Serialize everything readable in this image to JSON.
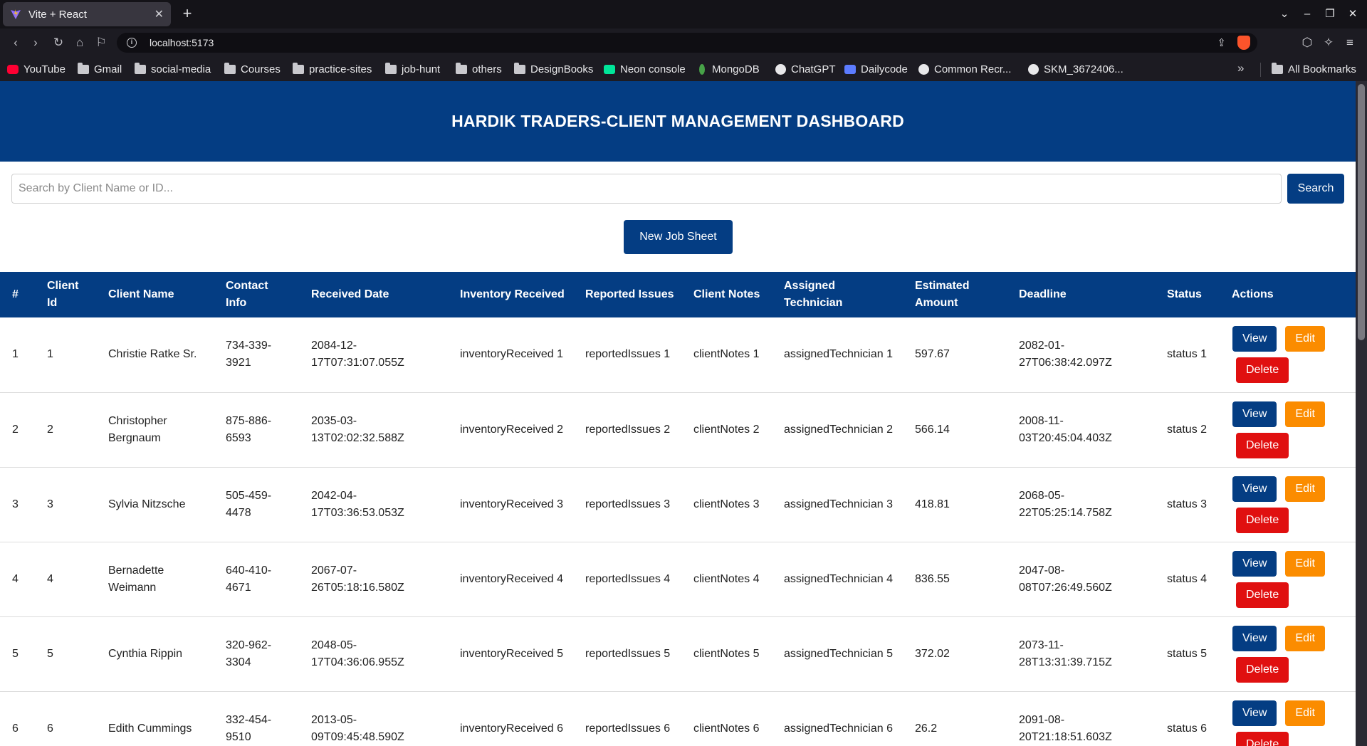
{
  "browser": {
    "tab_title": "Vite + React",
    "tab_close": "✕",
    "new_tab": "+",
    "url": "localhost:5173",
    "bookmarks": [
      {
        "label": "YouTube",
        "icon": "youtube-icon"
      },
      {
        "label": "Gmail",
        "icon": "folder-icon"
      },
      {
        "label": "social-media",
        "icon": "folder-icon"
      },
      {
        "label": "Courses",
        "icon": "folder-icon"
      },
      {
        "label": "practice-sites",
        "icon": "folder-icon"
      },
      {
        "label": "job-hunt",
        "icon": "folder-icon"
      },
      {
        "label": "others",
        "icon": "folder-icon"
      },
      {
        "label": "DesignBooks",
        "icon": "folder-icon"
      },
      {
        "label": "Neon console",
        "icon": "neon-icon"
      },
      {
        "label": "MongoDB",
        "icon": "mongodb-leaf-icon"
      },
      {
        "label": "ChatGPT",
        "icon": "chatgpt-icon"
      },
      {
        "label": "Dailycode",
        "icon": "dailycode-icon"
      },
      {
        "label": "Common Recr...",
        "icon": "globe-icon"
      },
      {
        "label": "SKM_3672406...",
        "icon": "globe-icon"
      }
    ],
    "all_bookmarks": "All Bookmarks",
    "more": "»"
  },
  "header": {
    "title": "HARDIK TRADERS-CLIENT MANAGEMENT DASHBOARD"
  },
  "search": {
    "placeholder": "Search by Client Name or ID...",
    "value": "",
    "button_label": "Search"
  },
  "new_job_sheet_label": "New Job Sheet",
  "table": {
    "headers": [
      "#",
      "Client Id",
      "Client Name",
      "Contact Info",
      "Received Date",
      "Inventory Received",
      "Reported Issues",
      "Client Notes",
      "Assigned Technician",
      "Estimated Amount",
      "Deadline",
      "Status",
      "Actions"
    ],
    "rows": [
      {
        "num": "1",
        "client_id": "1",
        "name": "Christie Ratke Sr.",
        "contact": "734-339-3921",
        "received": "2084-12-17T07:31:07.055Z",
        "inventory": "inventoryReceived 1",
        "issues": "reportedIssues 1",
        "notes": "clientNotes 1",
        "technician": "assignedTechnician 1",
        "amount": "597.67",
        "deadline": "2082-01-27T06:38:42.097Z",
        "status": "status 1"
      },
      {
        "num": "2",
        "client_id": "2",
        "name": "Christopher Bergnaum",
        "contact": "875-886-6593",
        "received": "2035-03-13T02:02:32.588Z",
        "inventory": "inventoryReceived 2",
        "issues": "reportedIssues 2",
        "notes": "clientNotes 2",
        "technician": "assignedTechnician 2",
        "amount": "566.14",
        "deadline": "2008-11-03T20:45:04.403Z",
        "status": "status 2"
      },
      {
        "num": "3",
        "client_id": "3",
        "name": "Sylvia Nitzsche",
        "contact": "505-459-4478",
        "received": "2042-04-17T03:36:53.053Z",
        "inventory": "inventoryReceived 3",
        "issues": "reportedIssues 3",
        "notes": "clientNotes 3",
        "technician": "assignedTechnician 3",
        "amount": "418.81",
        "deadline": "2068-05-22T05:25:14.758Z",
        "status": "status 3"
      },
      {
        "num": "4",
        "client_id": "4",
        "name": "Bernadette Weimann",
        "contact": "640-410-4671",
        "received": "2067-07-26T05:18:16.580Z",
        "inventory": "inventoryReceived 4",
        "issues": "reportedIssues 4",
        "notes": "clientNotes 4",
        "technician": "assignedTechnician 4",
        "amount": "836.55",
        "deadline": "2047-08-08T07:26:49.560Z",
        "status": "status 4"
      },
      {
        "num": "5",
        "client_id": "5",
        "name": "Cynthia Rippin",
        "contact": "320-962-3304",
        "received": "2048-05-17T04:36:06.955Z",
        "inventory": "inventoryReceived 5",
        "issues": "reportedIssues 5",
        "notes": "clientNotes 5",
        "technician": "assignedTechnician 5",
        "amount": "372.02",
        "deadline": "2073-11-28T13:31:39.715Z",
        "status": "status 5"
      },
      {
        "num": "6",
        "client_id": "6",
        "name": "Edith Cummings",
        "contact": "332-454-9510",
        "received": "2013-05-09T09:45:48.590Z",
        "inventory": "inventoryReceived 6",
        "issues": "reportedIssues 6",
        "notes": "clientNotes 6",
        "technician": "assignedTechnician 6",
        "amount": "26.2",
        "deadline": "2091-08-20T21:18:51.603Z",
        "status": "status 6"
      }
    ],
    "actions": {
      "view": "View",
      "edit": "Edit",
      "delete": "Delete"
    }
  },
  "colors": {
    "primary": "#043d83",
    "edit": "#fb8c00",
    "delete": "#e01010"
  }
}
